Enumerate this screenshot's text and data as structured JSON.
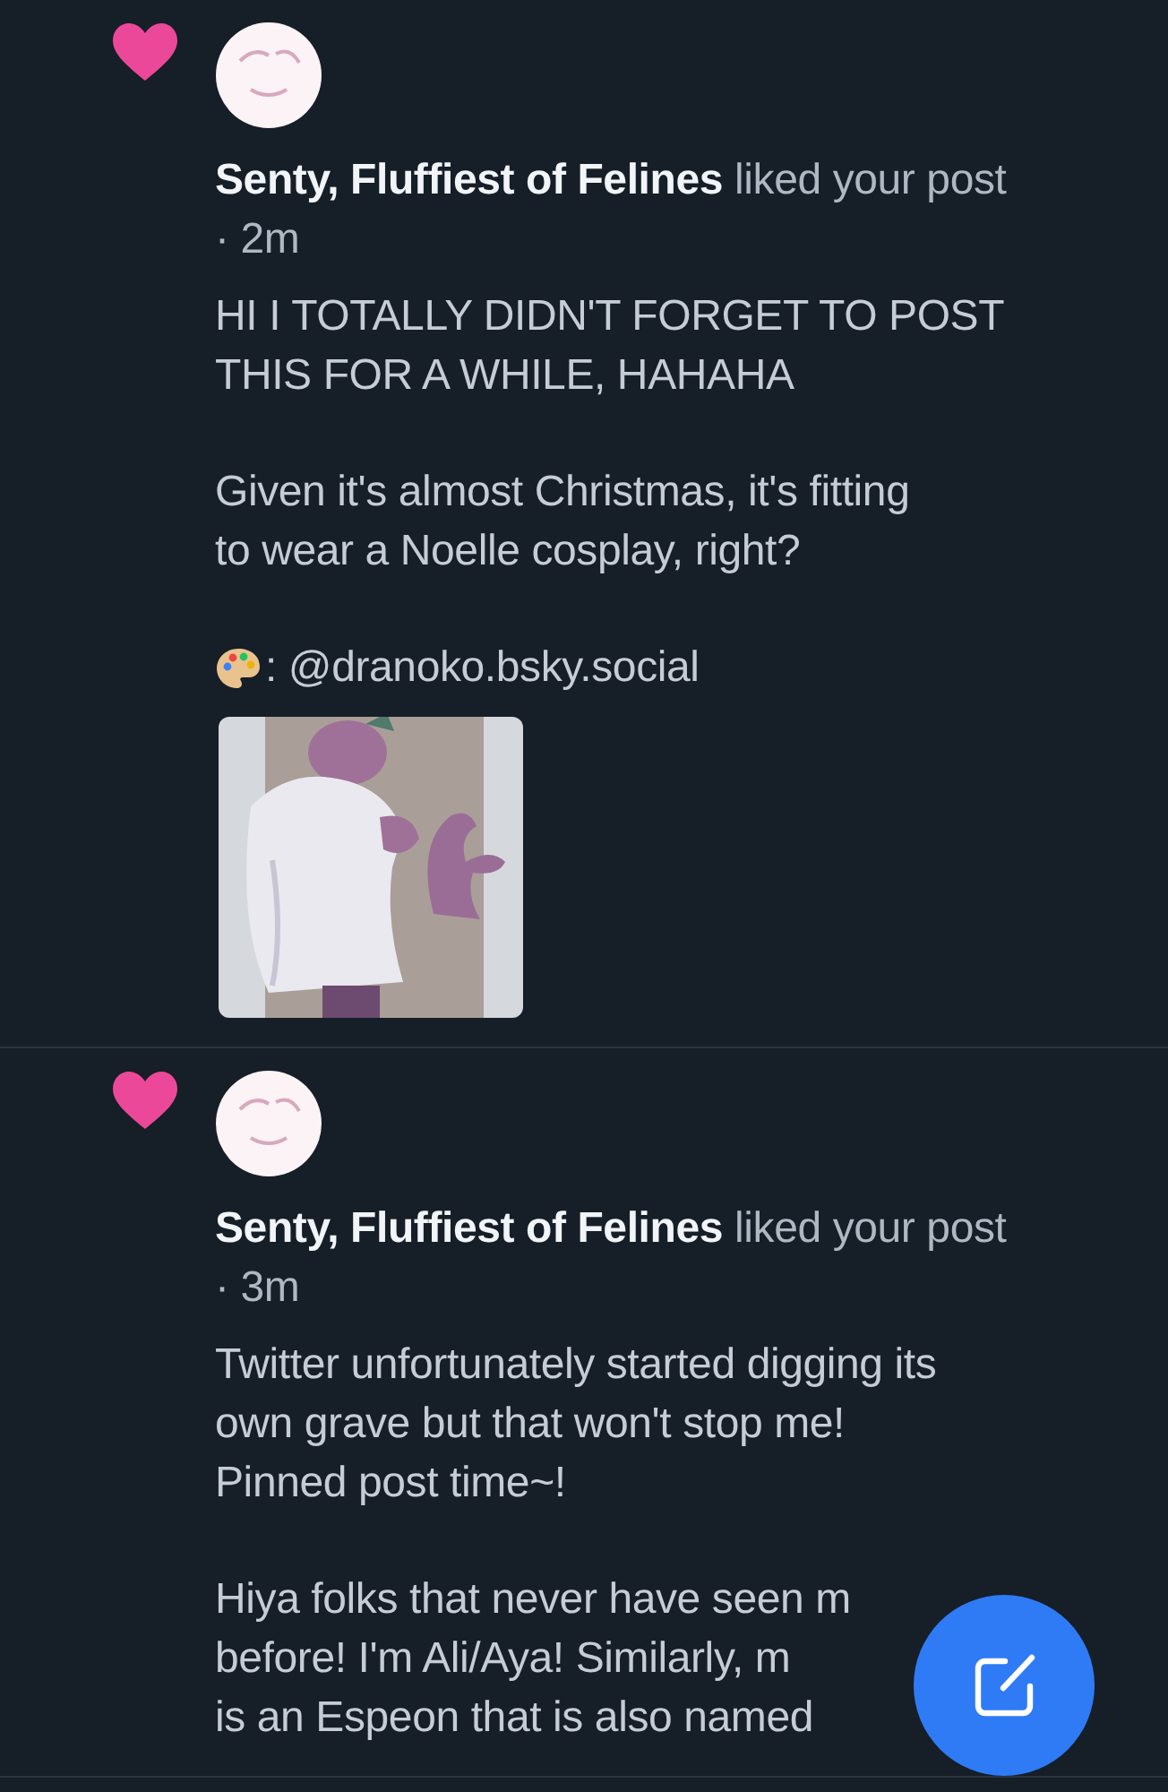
{
  "notifications": [
    {
      "meta": "**Senty, Fluffiest of Felines** liked your post · 2m",
      "blocks": [
        {
          "kind": "text",
          "lines": [
            "HI I TOTALLY DIDN'T FORGET TO POST",
            "THIS FOR A WHILE, HAHAHA"
          ]
        },
        {
          "kind": "text",
          "lines": [
            "Given it's almost Christmas, it's fitting",
            "to wear a Noelle cosplay, right?"
          ]
        },
        {
          "kind": "credit",
          "text": ": @dranoko.bsky.social"
        },
        {
          "kind": "picture"
        }
      ]
    },
    {
      "meta": "**Senty, Fluffiest of Felines** liked your post · 3m",
      "blocks": [
        {
          "kind": "text",
          "lines": [
            "Twitter unfortunately started digging its",
            "own grave but that won't stop me!",
            "Pinned post time~!"
          ]
        },
        {
          "kind": "text",
          "lines": [
            "Hiya folks that never have seen m",
            "before! I'm Ali/Aya! Similarly, m",
            "is an Espeon that is also named"
          ]
        }
      ]
    }
  ]
}
